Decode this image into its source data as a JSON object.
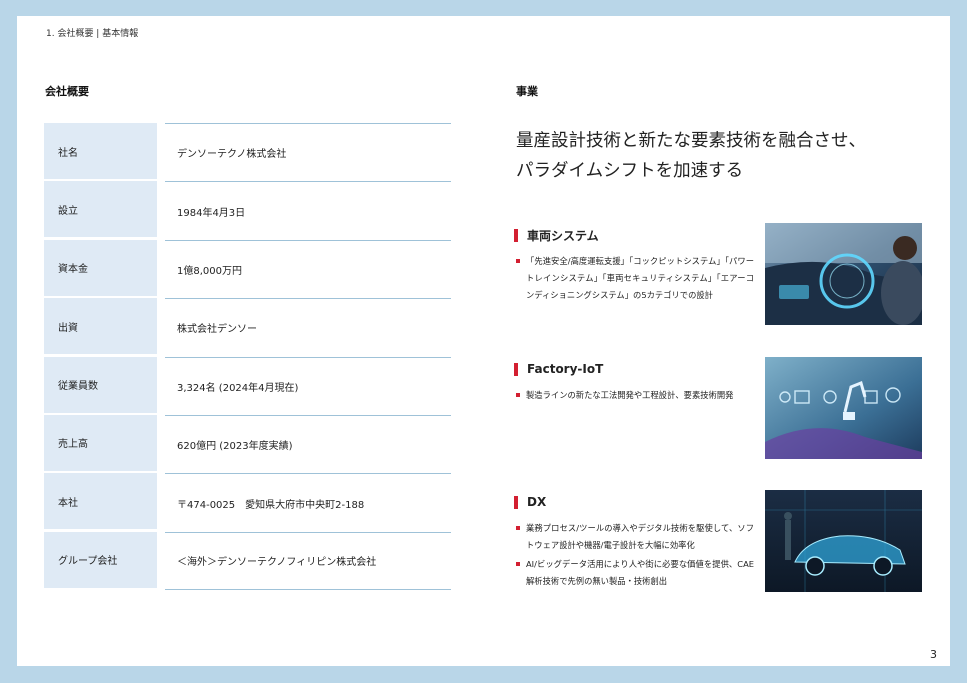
{
  "breadcrumb": "1. 会社概要 | 基本情報",
  "left_section_title": "会社概要",
  "right_section_title": "事業",
  "company_table": [
    {
      "label": "社名",
      "value": "デンソーテクノ株式会社"
    },
    {
      "label": "設立",
      "value": "1984年4月3日"
    },
    {
      "label": "資本金",
      "value": "1億8,000万円"
    },
    {
      "label": "出資",
      "value": "株式会社デンソー"
    },
    {
      "label": "従業員数",
      "value": "3,324名 (2024年4月現在)"
    },
    {
      "label": "売上高",
      "value": "620億円 (2023年度実績)"
    },
    {
      "label": "本社",
      "value": "〒474-0025　愛知県大府市中央町2-188"
    },
    {
      "label": "グループ会社",
      "value": "＜海外＞デンソーテクノフィリピン株式会社"
    }
  ],
  "headline": {
    "line1": "量産設計技術と新たな要素技術を融合させ、",
    "line2": "パラダイムシフトを加速する"
  },
  "businesses": [
    {
      "title": "車両システム",
      "items": [
        "「先進安全/高度運転支援」「コックピットシステム」「パワートレインシステム」「車両セキュリティシステム」「エアーコンディショニングシステム」の5カテゴリでの設計"
      ]
    },
    {
      "title": "Factory-IoT",
      "items": [
        "製造ラインの新たな工法開発や工程設計、要素技術開発"
      ]
    },
    {
      "title": "DX",
      "items": [
        "業務プロセス/ツールの導入やデジタル技術を駆使して、ソフトウェア設計や機器/電子設計を大幅に効率化",
        "AI/ビッグデータ活用により人や街に必要な価値を提供、CAE解析技術で先例の無い製品・技術創出"
      ]
    }
  ],
  "page_number": "3",
  "colors": {
    "accent": "#d31f31",
    "table_label_bg": "#dfeaf5",
    "frame": "#b9d6e8",
    "rule": "#9fc2d8"
  }
}
